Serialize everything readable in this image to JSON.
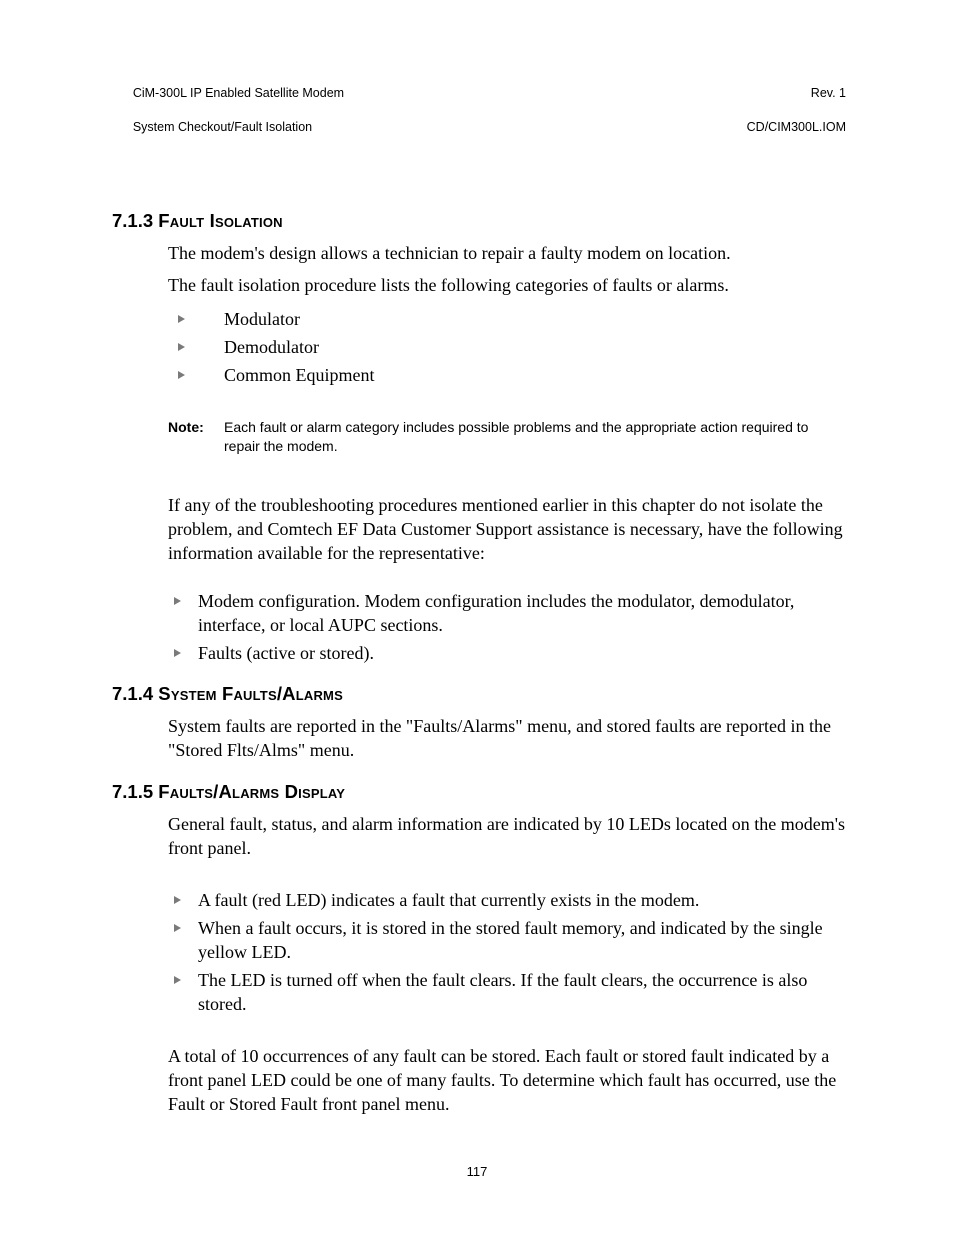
{
  "header": {
    "left_line1": "CiM-300L IP Enabled Satellite Modem",
    "left_line2": "System Checkout/Fault Isolation",
    "right_line1": "Rev. 1",
    "right_line2": "CD/CIM300L.IOM"
  },
  "sections": {
    "s713": {
      "num": "7.1.3",
      "title": "Fault Isolation",
      "p1": "The modem's design allows a technician to repair a faulty modem on location.",
      "p2": "The fault isolation procedure lists the following categories of faults or alarms.",
      "cats": [
        "Modulator",
        "Demodulator",
        "Common Equipment"
      ],
      "note_label": "Note:",
      "note_text": "Each fault or alarm category includes possible problems and the appropriate action required to repair the modem.",
      "p3": "If any of the troubleshooting procedures mentioned earlier in this chapter do not isolate the problem, and Comtech EF Data Customer Support assistance is necessary, have the following information available for the representative:",
      "info": [
        "Modem configuration. Modem configuration includes the modulator, demodulator, interface, or local AUPC sections.",
        "Faults (active or stored)."
      ]
    },
    "s714": {
      "num": "7.1.4",
      "title": "System Faults/Alarms",
      "p1": "System faults are reported in the \"Faults/Alarms\" menu, and stored faults are reported in the \"Stored Flts/Alms\" menu."
    },
    "s715": {
      "num": "7.1.5",
      "title": "Faults/Alarms Display",
      "p1": "General fault, status, and alarm information are indicated by 10 LEDs located on the modem's front panel.",
      "leds": [
        "A fault (red LED) indicates a fault that currently exists in the modem.",
        "When a fault occurs, it is stored in the stored fault memory, and indicated by the single yellow LED.",
        "The LED is turned off when the fault clears. If the fault clears, the occurrence is also stored."
      ],
      "p2": "A total of 10 occurrences of any fault can be stored. Each fault or stored fault indicated by a front panel LED could be one of many faults. To determine which fault has occurred, use the Fault or Stored Fault front panel menu."
    }
  },
  "page_number": "117"
}
